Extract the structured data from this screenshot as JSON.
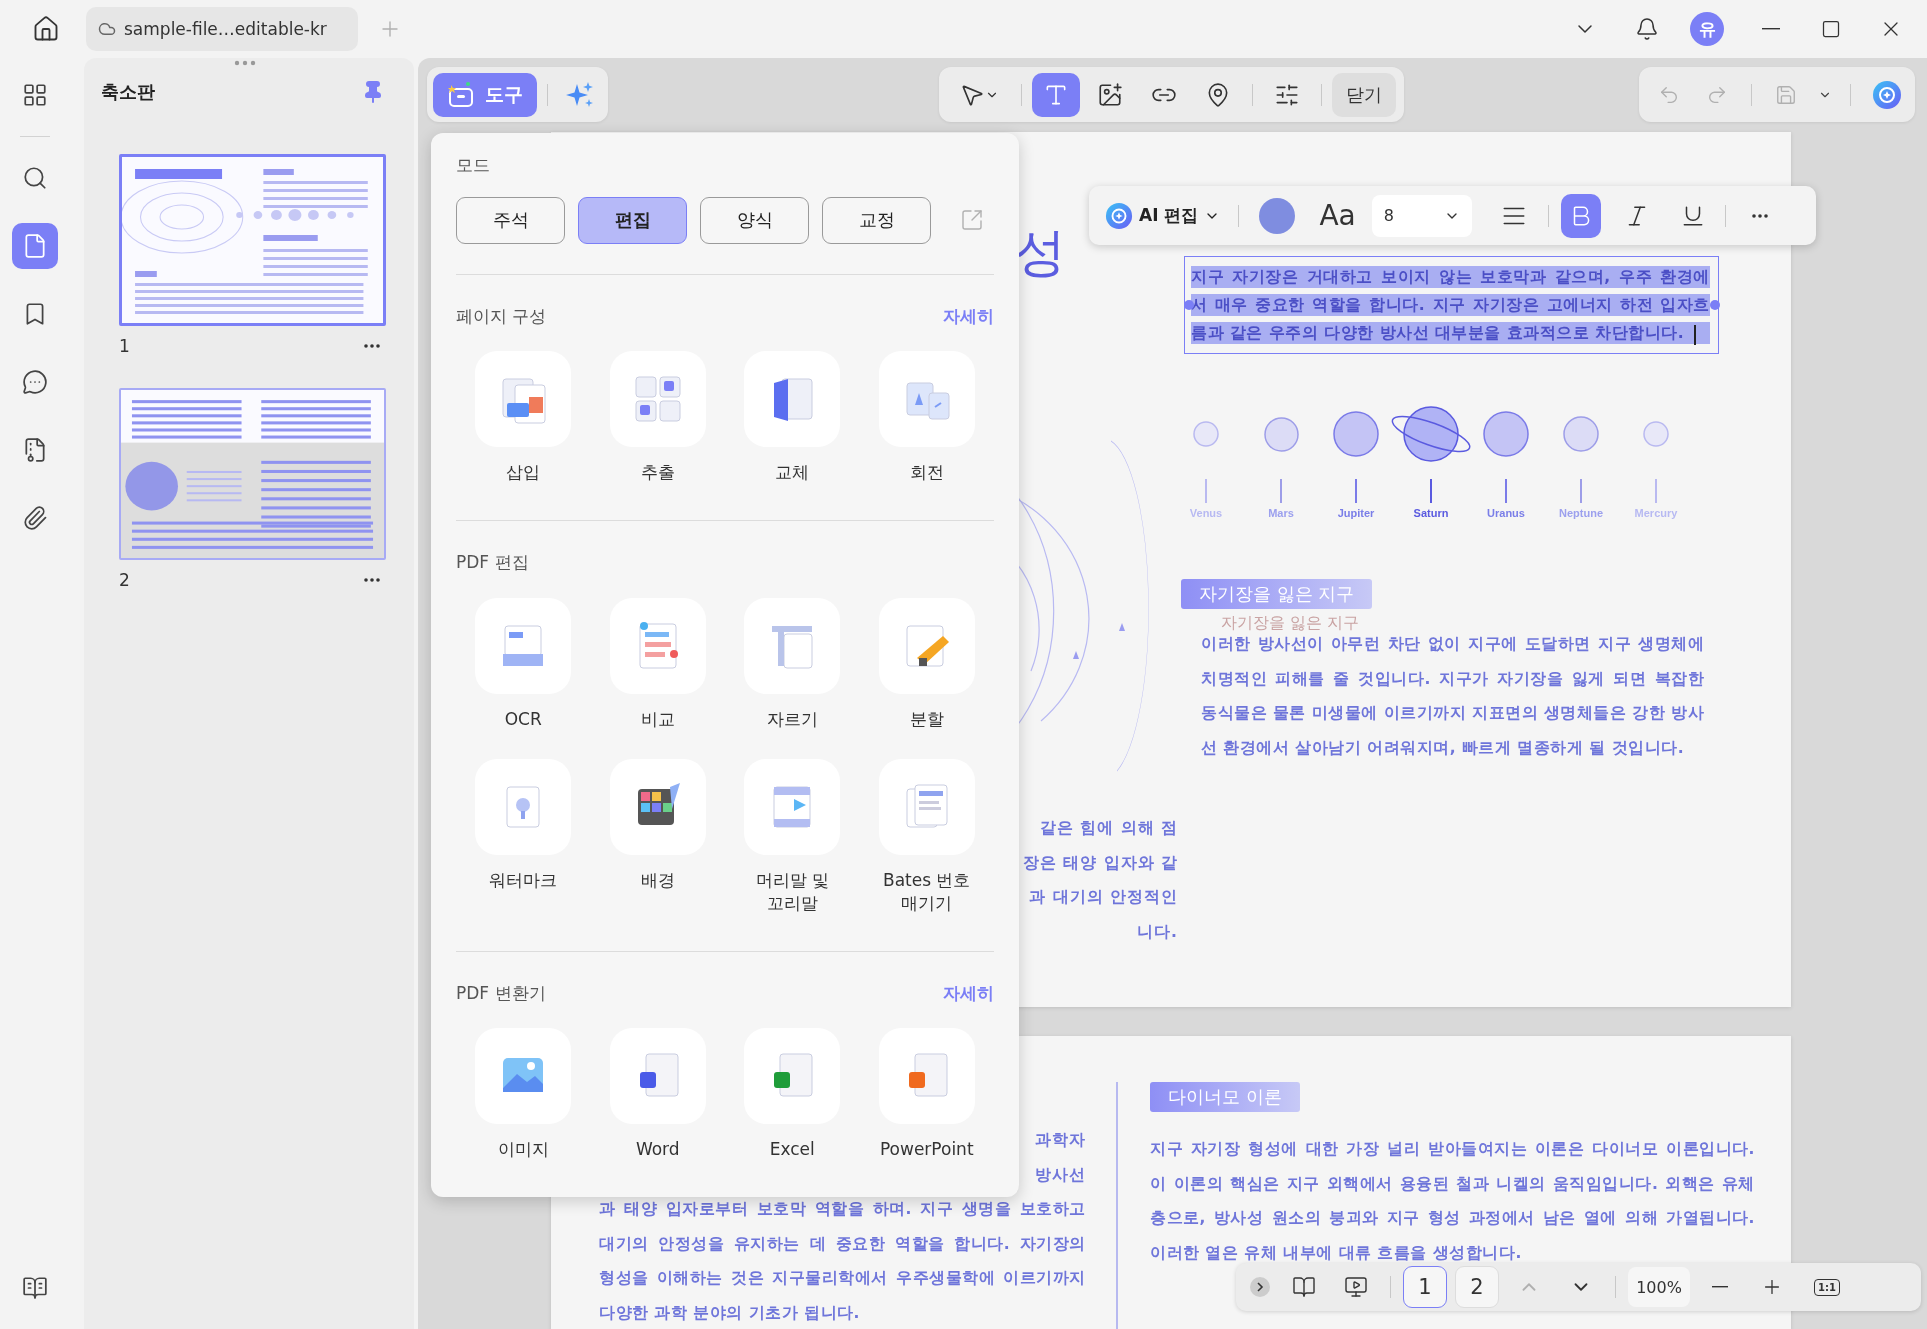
{
  "title_bar": {
    "tab": "sample-file…editable-kr",
    "avatar": "유"
  },
  "rail": [
    {
      "kind": "grid",
      "selected": false
    },
    {
      "kind": "search",
      "selected": false
    },
    {
      "kind": "page",
      "selected": true
    },
    {
      "kind": "bookmark",
      "selected": false
    },
    {
      "kind": "comment",
      "selected": false
    },
    {
      "kind": "stamp",
      "selected": false
    },
    {
      "kind": "attachment",
      "selected": false
    }
  ],
  "thumbnails": {
    "title": "축소판",
    "pages": [
      {
        "label": "1",
        "selected": true
      },
      {
        "label": "2",
        "selected": false
      }
    ]
  },
  "toolbar": {
    "tools": "도구",
    "tools_active": true,
    "edit_tools": [
      {
        "kind": "select",
        "selected": false
      },
      {
        "kind": "text",
        "selected": true
      },
      {
        "kind": "image",
        "selected": false
      },
      {
        "kind": "link",
        "selected": false
      },
      {
        "kind": "stamp",
        "selected": false
      },
      {
        "kind": "settings",
        "selected": false
      }
    ],
    "close": "닫기"
  },
  "format_bar": {
    "ai_label": "AI 편집",
    "color": "#7f8de0",
    "font_glyph": "Aa",
    "size": "8",
    "bold": true,
    "italic": false,
    "underline": false
  },
  "tools_panel": {
    "mode_title": "모드",
    "modes": [
      {
        "label": "주석",
        "selected": false
      },
      {
        "label": "편집",
        "selected": true
      },
      {
        "label": "양식",
        "selected": false
      },
      {
        "label": "교정",
        "selected": false
      }
    ],
    "sections": [
      {
        "title": "페이지 구성",
        "more": "자세히",
        "items": [
          {
            "kind": "insert",
            "label": "삽입"
          },
          {
            "kind": "extract",
            "label": "추출"
          },
          {
            "kind": "replace",
            "label": "교체"
          },
          {
            "kind": "rotate",
            "label": "회전"
          }
        ]
      },
      {
        "title": "PDF 편집",
        "items": [
          {
            "kind": "ocr",
            "label": "OCR"
          },
          {
            "kind": "compare",
            "label": "비교"
          },
          {
            "kind": "crop",
            "label": "자르기"
          },
          {
            "kind": "split",
            "label": "분할"
          },
          {
            "kind": "watermark",
            "label": "워터마크"
          },
          {
            "kind": "background",
            "label": "배경"
          },
          {
            "kind": "header",
            "label": "머리말 및\n꼬리말"
          },
          {
            "kind": "bates",
            "label": "Bates 번호\n매기기"
          }
        ]
      },
      {
        "title": "PDF 변환기",
        "more": "자세히",
        "items": [
          {
            "kind": "image",
            "label": "이미지"
          },
          {
            "kind": "word",
            "label": "Word"
          },
          {
            "kind": "excel",
            "label": "Excel"
          },
          {
            "kind": "powerpoint",
            "label": "PowerPoint"
          }
        ]
      }
    ]
  },
  "page1": {
    "title_fragment": "성",
    "selected_text": [
      "지구 자기장은 거대하고 보이지 않는 보호막과 같으며, 우주 환경에",
      "서 매우 중요한 역할을 합니다. 지구 자기장은 고에너지 하전 입자흐",
      "름과 같은 우주의 다양한 방사선 대부분을 효과적으로 차단합니다."
    ],
    "planets": [
      {
        "name": "Venus",
        "selected": false
      },
      {
        "name": "Mars",
        "selected": false
      },
      {
        "name": "Jupiter",
        "selected": false
      },
      {
        "name": "Saturn",
        "selected": true
      },
      {
        "name": "Uranus",
        "selected": false
      },
      {
        "name": "Neptune",
        "selected": false
      },
      {
        "name": "Mercury",
        "selected": false
      }
    ],
    "heading": "자기장을 잃은 지구",
    "ghost_heading": "자기장을 잃은 지구",
    "paragraph": [
      "이러한 방사선이 아무런 차단 없이 지구에 도달하면 지구 생명체에",
      "치명적인 피해를 줄 것입니다. 지구가 자기장을 잃게 되면 복잡한",
      "동식물은 물론 미생물에 이르기까지 지표면의 생명체들은 강한 방사",
      "선 환경에서 살아남기 어려워지며, 빠르게 멸종하게 될 것입니다."
    ],
    "cut_paragraph": [
      "같은 힘에 의해 점",
      "장은 태양 입자와 같",
      "과 대기의 안정적인",
      "니다."
    ]
  },
  "page2": {
    "left_fragments": [
      "과학자",
      "방사선"
    ],
    "left_paragraph": [
      "과 태양 입자로부터 보호막 역할을 하며. 지구 생명을 보호하고",
      "대기의 안정성을 유지하는 데 중요한 역할을 합니다. 자기장의",
      "형성을 이해하는 것은 지구물리학에서 우주생물학에 이르기까지",
      "다양한 과학 분야의 기초가 됩니다."
    ],
    "heading": "다이너모 이론",
    "paragraph": [
      "지구 자기장 형성에 대한 가장 널리 받아들여지는 이론은 다이너모 이론입니다.",
      "이 이론의 핵심은 지구 외핵에서 용융된 철과 니켈의 움직임입니다. 외핵은 유체",
      "층으로, 방사성 원소의 붕괴와 지구 형성 과정에서 남은 열에 의해 가열됩니다.",
      "이러한 열은 유체 내부에 대류 흐름을 생성합니다."
    ]
  },
  "page_nav": {
    "pages": [
      {
        "label": "1",
        "selected": true
      },
      {
        "label": "2",
        "selected": false
      }
    ],
    "zoom": "100%",
    "actual_size": "1:1"
  }
}
